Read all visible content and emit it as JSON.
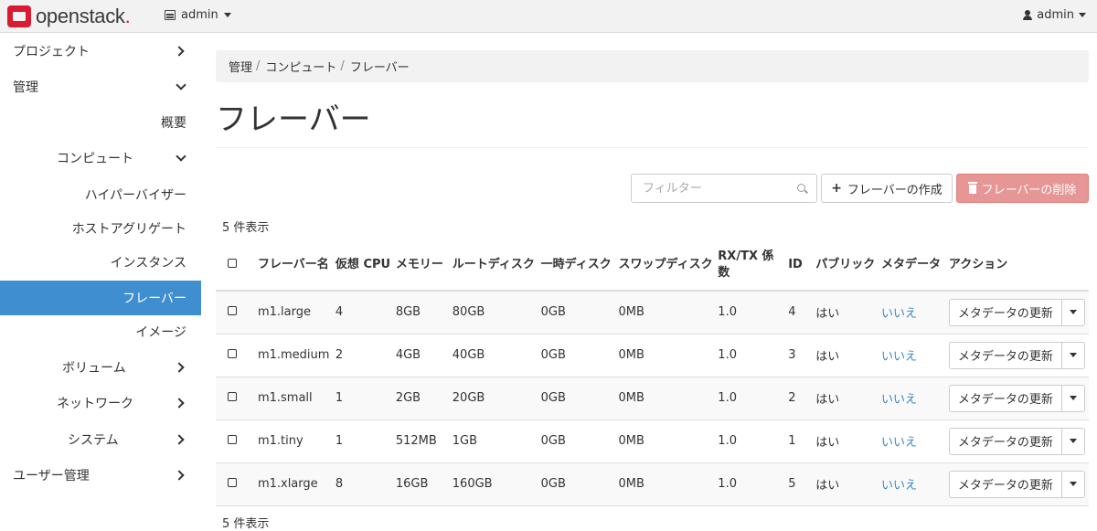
{
  "topbar": {
    "brand": "openstack",
    "brand_dot": ".",
    "project": "admin",
    "user": "admin"
  },
  "sidebar": {
    "items": [
      {
        "label": "プロジェクト",
        "icon": "chevron-right-icon"
      },
      {
        "label": "管理",
        "icon": "chevron-down-icon"
      },
      {
        "label": "概要"
      },
      {
        "label": "コンピュート",
        "icon": "chevron-down-icon"
      },
      {
        "label": "ハイパーバイザー"
      },
      {
        "label": "ホストアグリゲート"
      },
      {
        "label": "インスタンス"
      },
      {
        "label": "フレーバー",
        "active": true
      },
      {
        "label": "イメージ"
      },
      {
        "label": "ボリューム",
        "icon": "chevron-right-icon"
      },
      {
        "label": "ネットワーク",
        "icon": "chevron-right-icon"
      },
      {
        "label": "システム",
        "icon": "chevron-right-icon"
      },
      {
        "label": "ユーザー管理",
        "icon": "chevron-right-icon"
      }
    ]
  },
  "breadcrumb": [
    "管理",
    "コンピュート",
    "フレーバー"
  ],
  "page_title": "フレーバー",
  "toolbar": {
    "filter_placeholder": "フィルター",
    "create_label": "フレーバーの作成",
    "delete_label": "フレーバーの削除",
    "delete_color": "#e69694"
  },
  "count_label": "5 件表示",
  "table": {
    "headers": [
      "フレーバー名",
      "仮想 CPU",
      "メモリー",
      "ルートディスク",
      "一時ディスク",
      "スワップディスク",
      "RX/TX 係数",
      "ID",
      "パブリック",
      "メタデータ",
      "アクション"
    ],
    "rows": [
      {
        "name": "m1.large",
        "vcpu": "4",
        "ram": "8GB",
        "root": "80GB",
        "eph": "0GB",
        "swap": "0MB",
        "rxtx": "1.0",
        "id": "4",
        "public": "はい",
        "metadata": "いいえ",
        "action": "メタデータの更新"
      },
      {
        "name": "m1.medium",
        "vcpu": "2",
        "ram": "4GB",
        "root": "40GB",
        "eph": "0GB",
        "swap": "0MB",
        "rxtx": "1.0",
        "id": "3",
        "public": "はい",
        "metadata": "いいえ",
        "action": "メタデータの更新"
      },
      {
        "name": "m1.small",
        "vcpu": "1",
        "ram": "2GB",
        "root": "20GB",
        "eph": "0GB",
        "swap": "0MB",
        "rxtx": "1.0",
        "id": "2",
        "public": "はい",
        "metadata": "いいえ",
        "action": "メタデータの更新"
      },
      {
        "name": "m1.tiny",
        "vcpu": "1",
        "ram": "512MB",
        "root": "1GB",
        "eph": "0GB",
        "swap": "0MB",
        "rxtx": "1.0",
        "id": "1",
        "public": "はい",
        "metadata": "いいえ",
        "action": "メタデータの更新"
      },
      {
        "name": "m1.xlarge",
        "vcpu": "8",
        "ram": "16GB",
        "root": "160GB",
        "eph": "0GB",
        "swap": "0MB",
        "rxtx": "1.0",
        "id": "5",
        "public": "はい",
        "metadata": "いいえ",
        "action": "メタデータの更新"
      }
    ]
  },
  "colors": {
    "accent": "#3f8ed0",
    "link": "#3a87c8",
    "brand": "#da1a32"
  }
}
